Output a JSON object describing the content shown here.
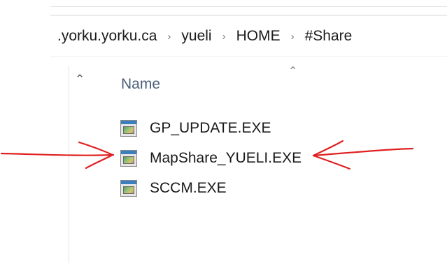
{
  "breadcrumb": {
    "items": [
      ".yorku.yorku.ca",
      "yueli",
      "HOME",
      "#Share"
    ],
    "separator": "›"
  },
  "nav_pane": {
    "collapse_icon": "chevron-up-icon"
  },
  "file_list": {
    "sort_indicator_icon": "sort-ascending-icon",
    "column_header": "Name",
    "files": [
      {
        "name": "GP_UPDATE.EXE",
        "icon": "executable-icon"
      },
      {
        "name": "MapShare_YUELI.EXE",
        "icon": "executable-icon",
        "highlighted": true
      },
      {
        "name": "SCCM.EXE",
        "icon": "executable-icon"
      }
    ]
  },
  "annotation": {
    "color": "#e02020",
    "description_icon": "hand-drawn-arrows"
  }
}
